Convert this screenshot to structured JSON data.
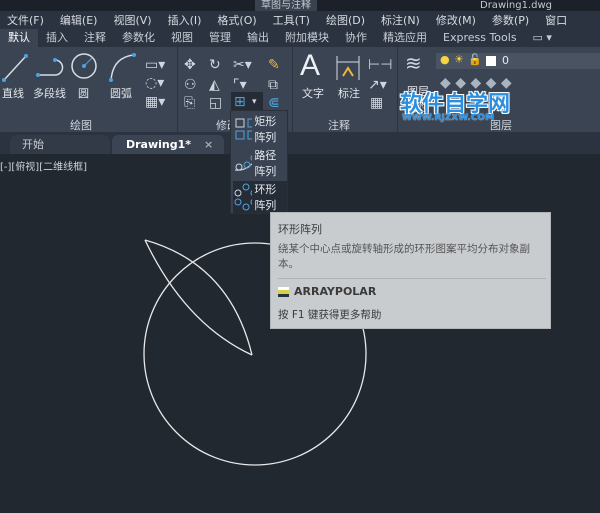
{
  "titlebar": {
    "workspace": "草图与注释",
    "doc": "Drawing1.dwg"
  },
  "menu": [
    "文件(F)",
    "编辑(E)",
    "视图(V)",
    "插入(I)",
    "格式(O)",
    "工具(T)",
    "绘图(D)",
    "标注(N)",
    "修改(M)",
    "参数(P)",
    "窗口"
  ],
  "ribbon_tabs": [
    "默认",
    "插入",
    "注释",
    "参数化",
    "视图",
    "管理",
    "输出",
    "附加模块",
    "协作",
    "精选应用",
    "Express Tools"
  ],
  "ribbon": {
    "draw": {
      "line": "直线",
      "polyline": "多段线",
      "circle": "圆",
      "arc": "圆弧",
      "title": "绘图"
    },
    "modify": {
      "title": "修改"
    },
    "annotation": {
      "text": "文字",
      "dimension": "标注",
      "title": "注释"
    },
    "layers": {
      "layer_props": "图层",
      "props_label": "特性",
      "current_layer": "0",
      "title": "图层"
    }
  },
  "watermark": {
    "name": "软件自学网",
    "url": "WWW.RJZXW.COM"
  },
  "file_tabs": {
    "start": "开始",
    "drawing": "Drawing1*",
    "close": "×"
  },
  "viewport_label": "[-][俯视][二维线框]",
  "array_menu": {
    "items": [
      "矩形阵列",
      "路径阵列",
      "环形阵列"
    ],
    "selected": "环形阵列"
  },
  "tooltip": {
    "title": "环形阵列",
    "description": "绕某个中心点或旋转轴形成的环形图案平均分布对象副本。",
    "command": "ARRAYPOLAR",
    "help": "按 F1 键获得更多帮助"
  },
  "colors": {
    "canvas": "#212830",
    "ribbon": "#3b4453",
    "accent": "#4da3e0"
  }
}
